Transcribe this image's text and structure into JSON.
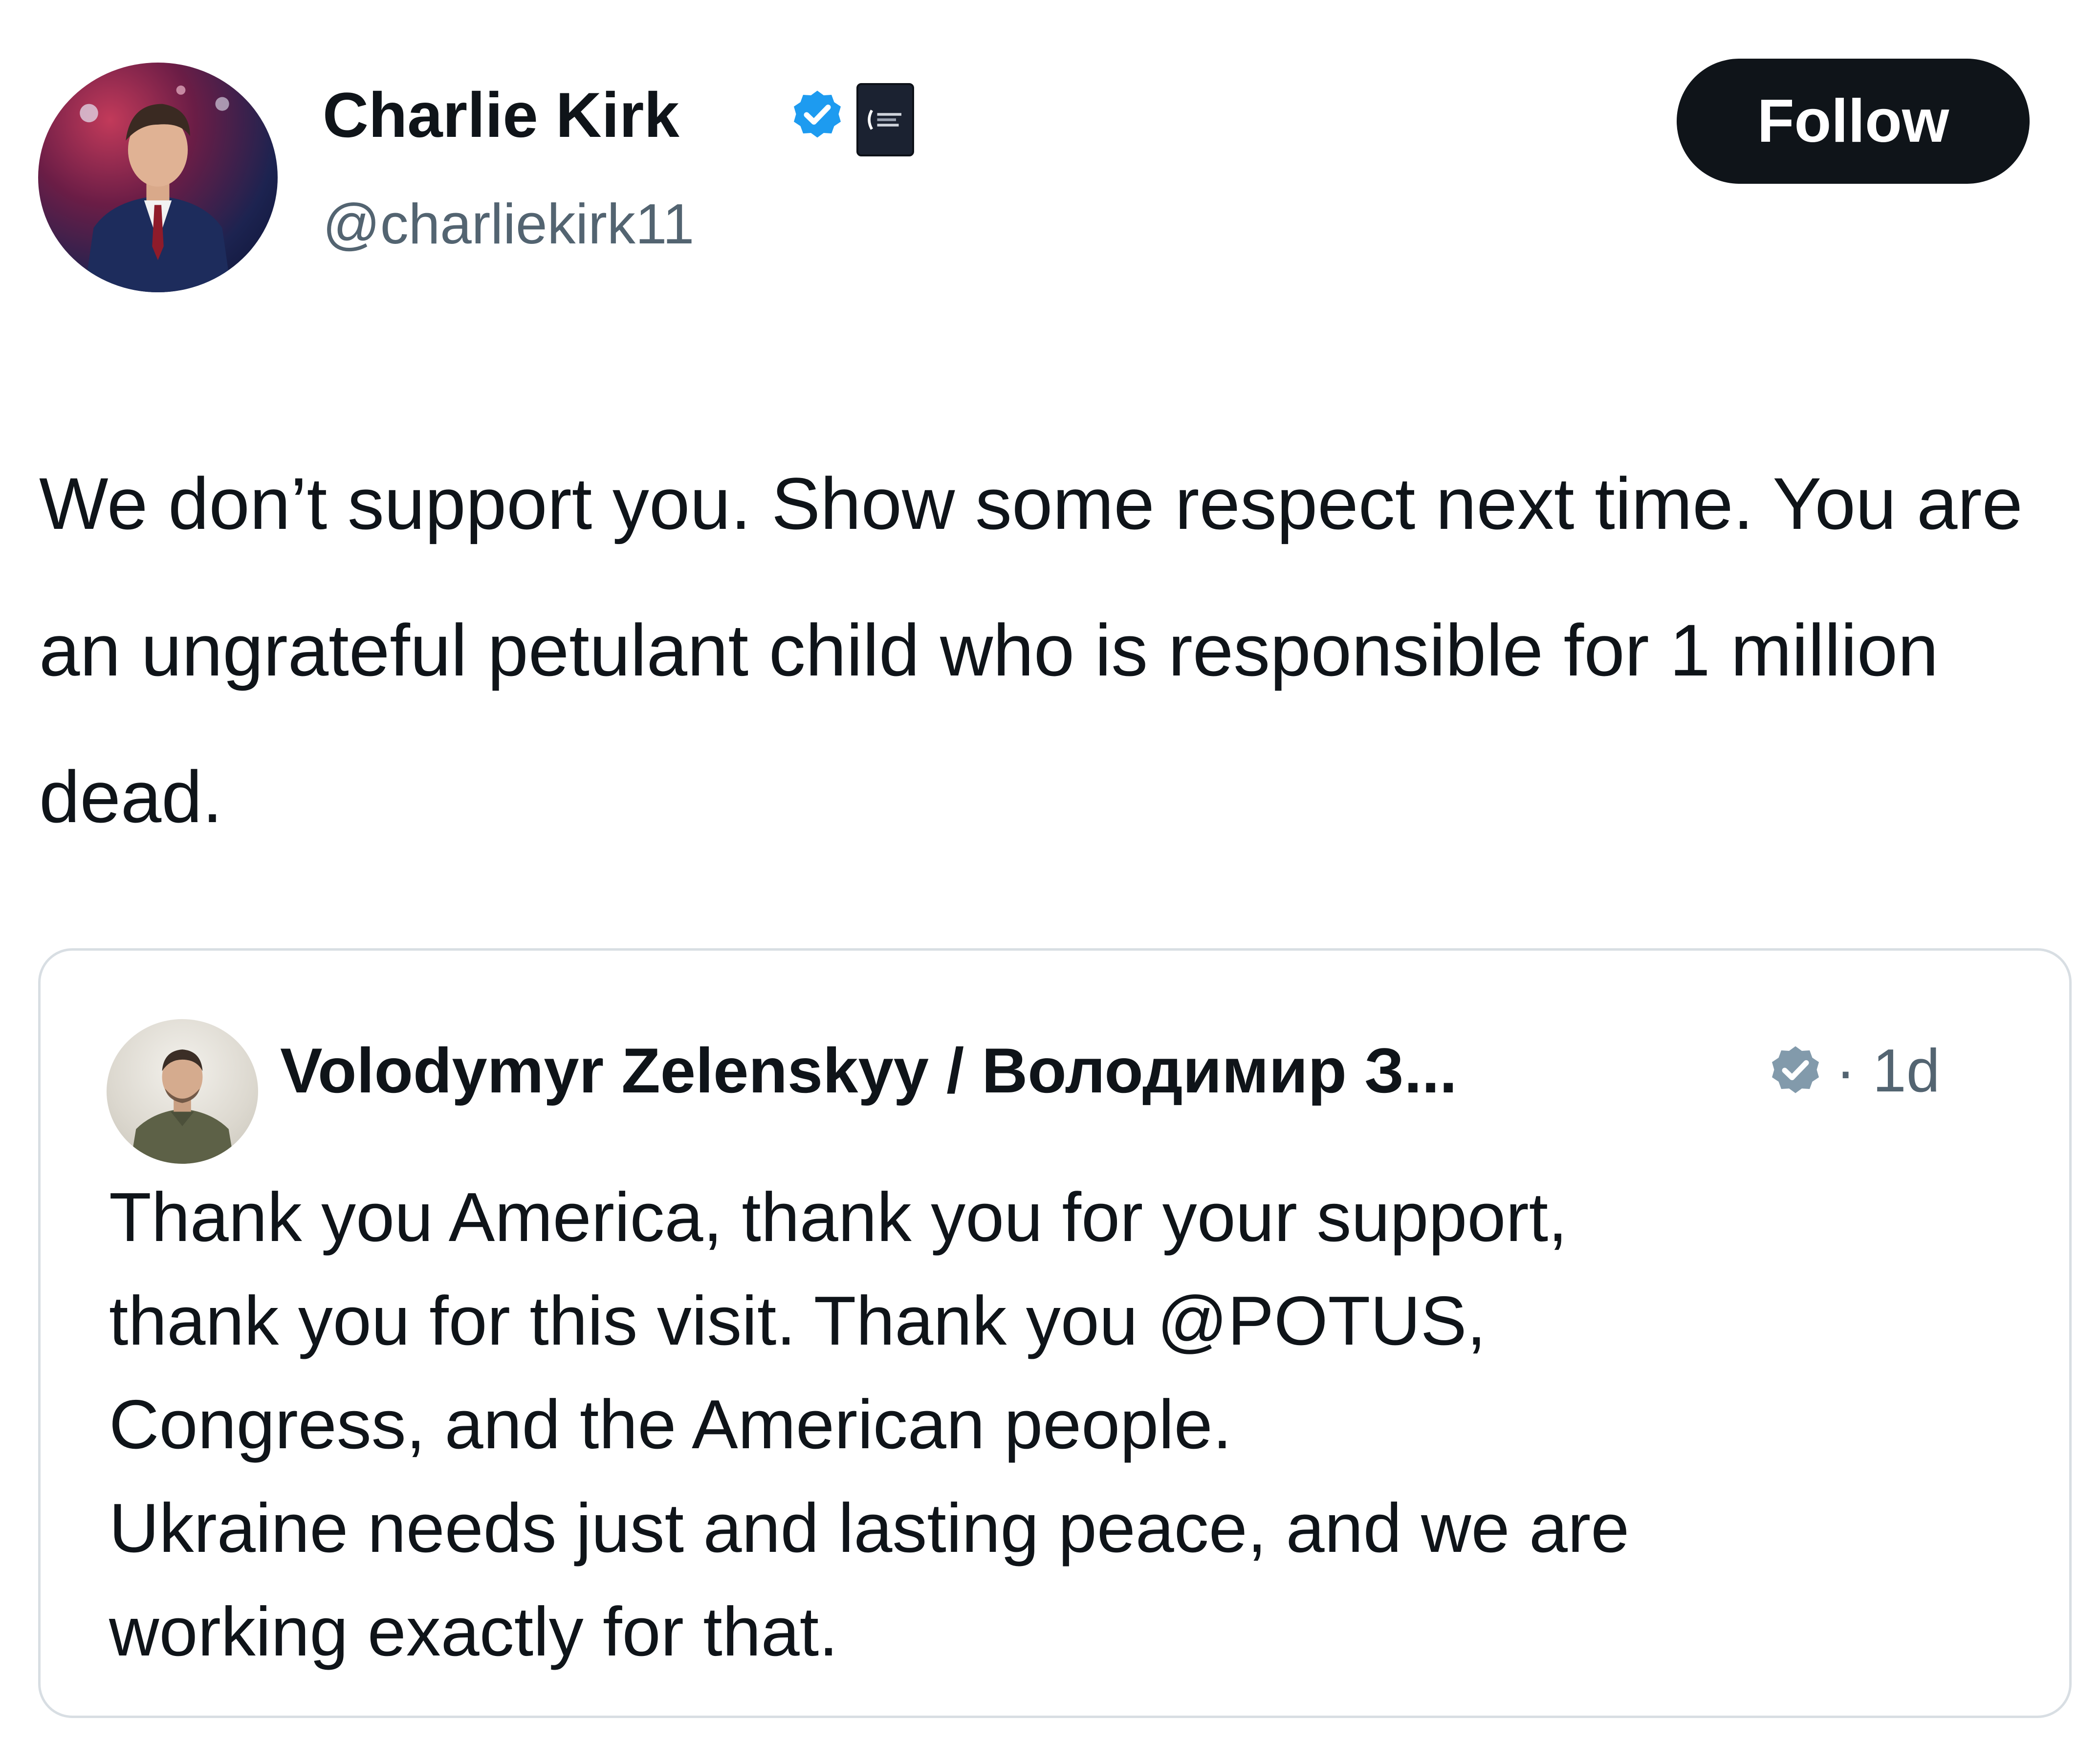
{
  "author": {
    "name": "Charlie Kirk",
    "handle": "@charliekirk11",
    "avatar_icon": "profile-photo",
    "verified_icon": "verified-badge-icon",
    "org_badge_icon": "affiliation-badge-icon"
  },
  "follow_button": {
    "label": "Follow"
  },
  "tweet": {
    "text": "We don’t support you. Show some respect next time. You are an ungrateful petulant child who is responsible for 1 million dead."
  },
  "quoted_tweet": {
    "name": "Volodymyr Zelenskyy / Володимир З...",
    "time": "· 1d",
    "verified_icon": "verified-badge-icon",
    "lines": [
      "Thank you America, thank you for your support,",
      "thank you for this visit. Thank you @POTUS,",
      "Congress, and the American people.",
      "Ukraine needs just and lasting peace, and we are",
      "working exactly for that."
    ]
  },
  "colors": {
    "text_primary": "#0f1419",
    "text_secondary": "#536471",
    "verified_blue": "#1d9bf0",
    "verified_grey": "#829aab",
    "follow_bg": "#0f1419",
    "card_border": "#d8dee3"
  }
}
